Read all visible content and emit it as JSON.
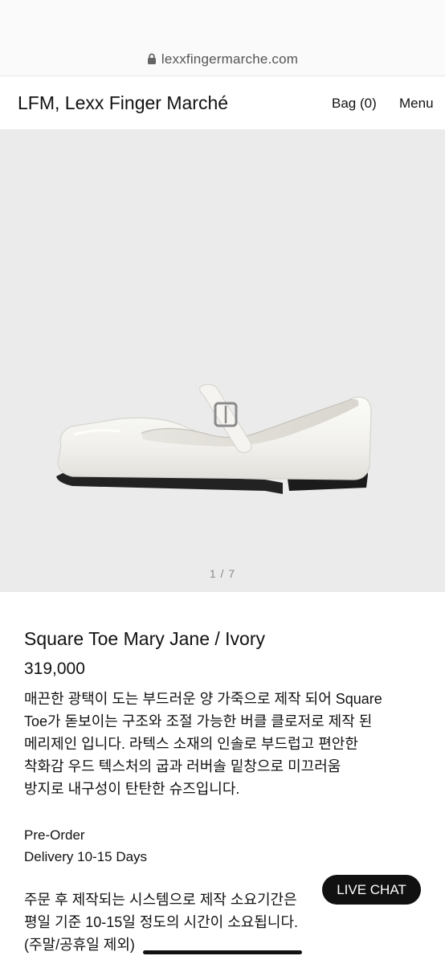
{
  "browser": {
    "url": "lexxfingermarche.com",
    "lock_icon": "lock-icon"
  },
  "header": {
    "brand": "LFM, Lexx Finger Marché",
    "bag_label": "Bag (0)",
    "menu_label": "Menu"
  },
  "gallery": {
    "counter": "1 / 7",
    "image_subject": "shoe-image"
  },
  "product": {
    "title": "Square Toe Mary Jane / Ivory",
    "price": "319,000",
    "description_lines": [
      "매끈한 광택이 도는 부드러운 양 가죽으로 제작 되어 Square",
      "Toe가 돋보이는 구조와 조절 가능한 버클 클로저로 제작 된",
      "메리제인 입니다. 라텍스 소재의 인솔로 부드럽고 편안한",
      "착화감 우드 텍스처의 굽과 러버솔 밑창으로 미끄러움",
      "방지로 내구성이 탄탄한 슈즈입니다."
    ],
    "preorder": "Pre-Order",
    "delivery": "Delivery 10-15 Days",
    "notice_lines": [
      "주문 후 제작되는 시스템으로 제작 소요기간은",
      "평일 기준 10-15일 정도의 시간이 소요됩니다.",
      "(주말/공휴일 제외)"
    ]
  },
  "chat": {
    "label": "LIVE CHAT"
  },
  "colors": {
    "gallery_bg": "#ebebeb",
    "text": "#111111",
    "chat_bg": "#111111"
  }
}
